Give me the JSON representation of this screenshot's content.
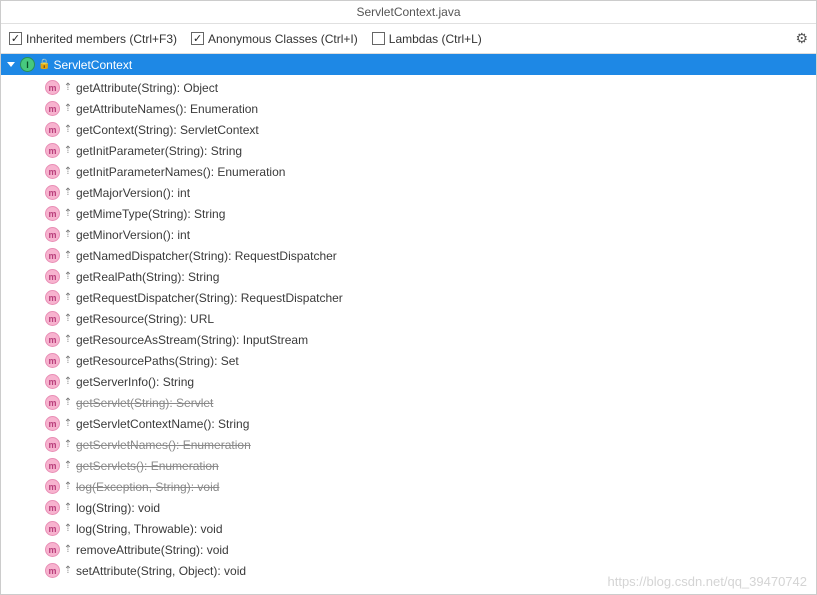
{
  "title": "ServletContext.java",
  "toolbar": {
    "inherited": {
      "label": "Inherited members (Ctrl+F3)",
      "checked": true
    },
    "anonymous": {
      "label": "Anonymous Classes (Ctrl+I)",
      "checked": true
    },
    "lambdas": {
      "label": "Lambdas (Ctrl+L)",
      "checked": false
    }
  },
  "root": {
    "label": "ServletContext"
  },
  "methods": [
    {
      "label": "getAttribute(String): Object",
      "deprecated": false
    },
    {
      "label": "getAttributeNames(): Enumeration",
      "deprecated": false
    },
    {
      "label": "getContext(String): ServletContext",
      "deprecated": false
    },
    {
      "label": "getInitParameter(String): String",
      "deprecated": false
    },
    {
      "label": "getInitParameterNames(): Enumeration",
      "deprecated": false
    },
    {
      "label": "getMajorVersion(): int",
      "deprecated": false
    },
    {
      "label": "getMimeType(String): String",
      "deprecated": false
    },
    {
      "label": "getMinorVersion(): int",
      "deprecated": false
    },
    {
      "label": "getNamedDispatcher(String): RequestDispatcher",
      "deprecated": false
    },
    {
      "label": "getRealPath(String): String",
      "deprecated": false
    },
    {
      "label": "getRequestDispatcher(String): RequestDispatcher",
      "deprecated": false
    },
    {
      "label": "getResource(String): URL",
      "deprecated": false
    },
    {
      "label": "getResourceAsStream(String): InputStream",
      "deprecated": false
    },
    {
      "label": "getResourcePaths(String): Set",
      "deprecated": false
    },
    {
      "label": "getServerInfo(): String",
      "deprecated": false
    },
    {
      "label": "getServlet(String): Servlet",
      "deprecated": true
    },
    {
      "label": "getServletContextName(): String",
      "deprecated": false
    },
    {
      "label": "getServletNames(): Enumeration",
      "deprecated": true
    },
    {
      "label": "getServlets(): Enumeration",
      "deprecated": true
    },
    {
      "label": "log(Exception, String): void",
      "deprecated": true
    },
    {
      "label": "log(String): void",
      "deprecated": false
    },
    {
      "label": "log(String, Throwable): void",
      "deprecated": false
    },
    {
      "label": "removeAttribute(String): void",
      "deprecated": false
    },
    {
      "label": "setAttribute(String, Object): void",
      "deprecated": false
    }
  ],
  "icons": {
    "method_letter": "m",
    "interface_letter": "I",
    "inherit_glyph": "⇡"
  },
  "watermark": "https://blog.csdn.net/qq_39470742"
}
